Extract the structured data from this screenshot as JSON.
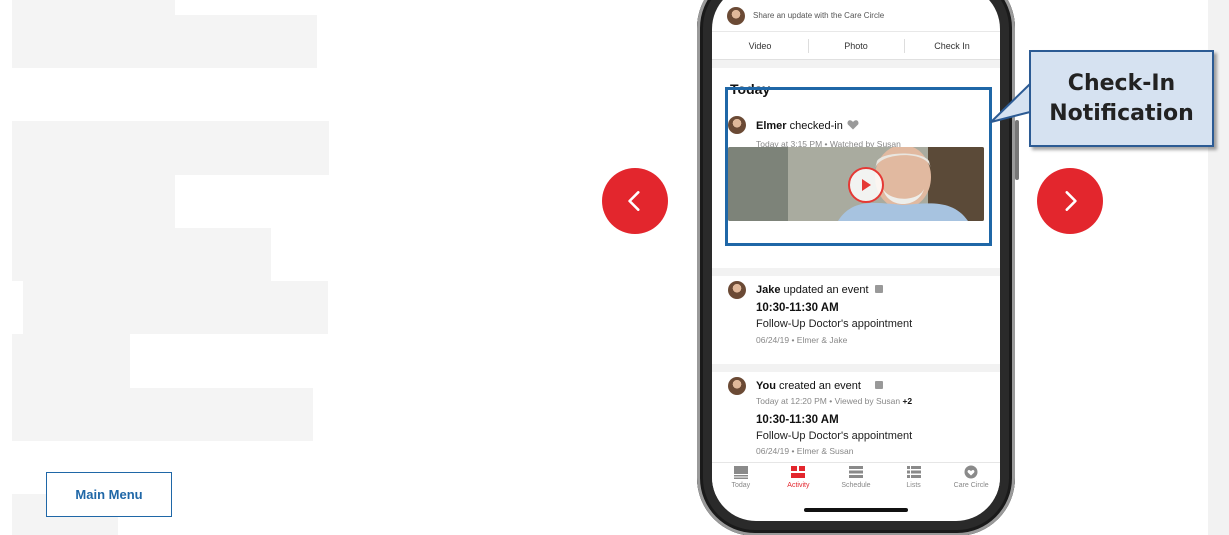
{
  "left_panel": {
    "main_menu_label": "Main Menu"
  },
  "carousel": {
    "prev_icon": "chevron-left-icon",
    "next_icon": "chevron-right-icon",
    "accent_color": "#e3262d"
  },
  "app": {
    "share_placeholder": "Share an update with the Care Circle",
    "media_buttons": [
      "Video",
      "Photo",
      "Check In"
    ],
    "section_title": "Today",
    "feed": [
      {
        "user": "Elmer",
        "action": " checked-in",
        "meta": "Today at 3:15 PM  •  Watched by Susan"
      },
      {
        "user": "Jake",
        "action": " updated an event",
        "time": "10:30-11:30 AM",
        "title": "Follow-Up Doctor's appointment",
        "meta": "06/24/19  •  Elmer & Jake"
      },
      {
        "user": "You",
        "action": " created an event",
        "meta_prefix": "Today at 12:20 PM  •  Viewed by Susan ",
        "meta_extra": "+2",
        "time": "10:30-11:30 AM",
        "title": "Follow-Up Doctor's appointment",
        "meta": "06/24/19  •  Elmer & Susan"
      }
    ],
    "tabs": [
      {
        "label": "Today",
        "icon": "today-icon"
      },
      {
        "label": "Activity",
        "icon": "activity-icon",
        "active": true
      },
      {
        "label": "Schedule",
        "icon": "schedule-icon"
      },
      {
        "label": "Lists",
        "icon": "lists-icon"
      },
      {
        "label": "Care Circle",
        "icon": "heart-icon"
      }
    ]
  },
  "callout": {
    "text": "Check-In\nNotification",
    "highlight_color": "#1f67a7"
  }
}
